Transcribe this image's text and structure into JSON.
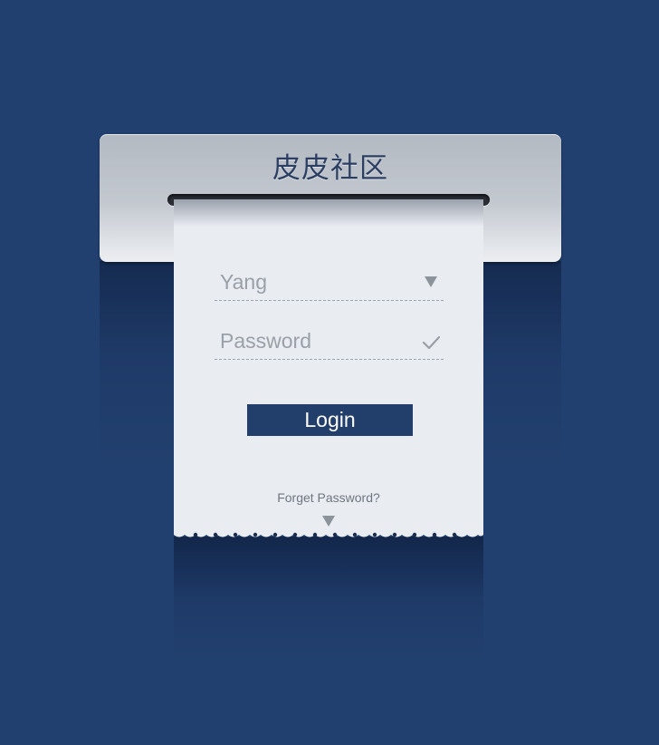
{
  "app": {
    "title": "皮皮社区"
  },
  "login_form": {
    "username_value": "Yang",
    "password_placeholder": "Password",
    "login_label": "Login",
    "forget_password_label": "Forget Password?"
  },
  "icons": {
    "username_dropdown": "triangle-down-icon",
    "password_status": "checkmark-icon",
    "forget_expand": "triangle-down-icon"
  },
  "colors": {
    "background": "#22406f",
    "button": "#223e6b",
    "paper": "#e9ecf1",
    "title_text": "#2c3f62"
  }
}
